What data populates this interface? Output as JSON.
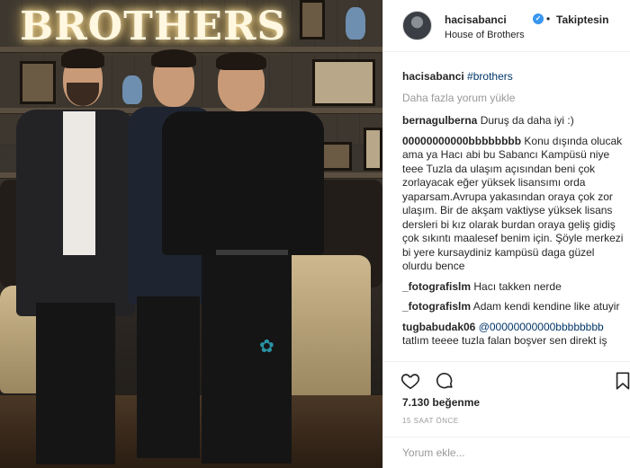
{
  "photo": {
    "sign_text": "BROTHERS",
    "watermark_icon": "clover-icon"
  },
  "header": {
    "username": "hacisabanci",
    "verified_icon": "verified-badge-icon",
    "separator": "•",
    "follow_state": "Takiptesin",
    "location": "House of Brothers"
  },
  "caption": {
    "username": "hacisabanci",
    "text": "#brothers"
  },
  "load_more": "Daha fazla yorum yükle",
  "comments": [
    {
      "user": "bernagulberna",
      "text": "Duruş da daha iyi :)"
    },
    {
      "user": "00000000000bbbbbbbb",
      "text": "Konu dışında olucak ama ya Hacı abi bu Sabancı Kampüsü niye teee Tuzla da ulaşım açısından beni çok zorlayacak eğer yüksek lisansımı orda yaparsam.Avrupa yakasından oraya çok zor ulaşım. Bir de akşam vaktiyse yüksek lisans dersleri bi kız olarak burdan oraya geliş gidiş çok sıkıntı maalesef benim için. Şöyle merkezi bi yere kursaydiniz kampüsü daga güzel olurdu bence"
    },
    {
      "user": "_fotografislm",
      "text": "Hacı takken nerde"
    },
    {
      "user": "_fotografislm",
      "text": "Adam kendi kendine like atuyir"
    },
    {
      "user": "tugbabudak06",
      "mention": "@00000000000bbbbbbbb",
      "text": "tatlım teeee tuzla falan boşver sen direkt iş"
    }
  ],
  "actions": {
    "like_icon": "heart-icon",
    "comment_icon": "comment-icon",
    "save_icon": "bookmark-icon"
  },
  "likes": "7.130 beğenme",
  "timestamp": "15 SAAT ÖNCE",
  "add_comment": {
    "placeholder": "Yorum ekle..."
  }
}
